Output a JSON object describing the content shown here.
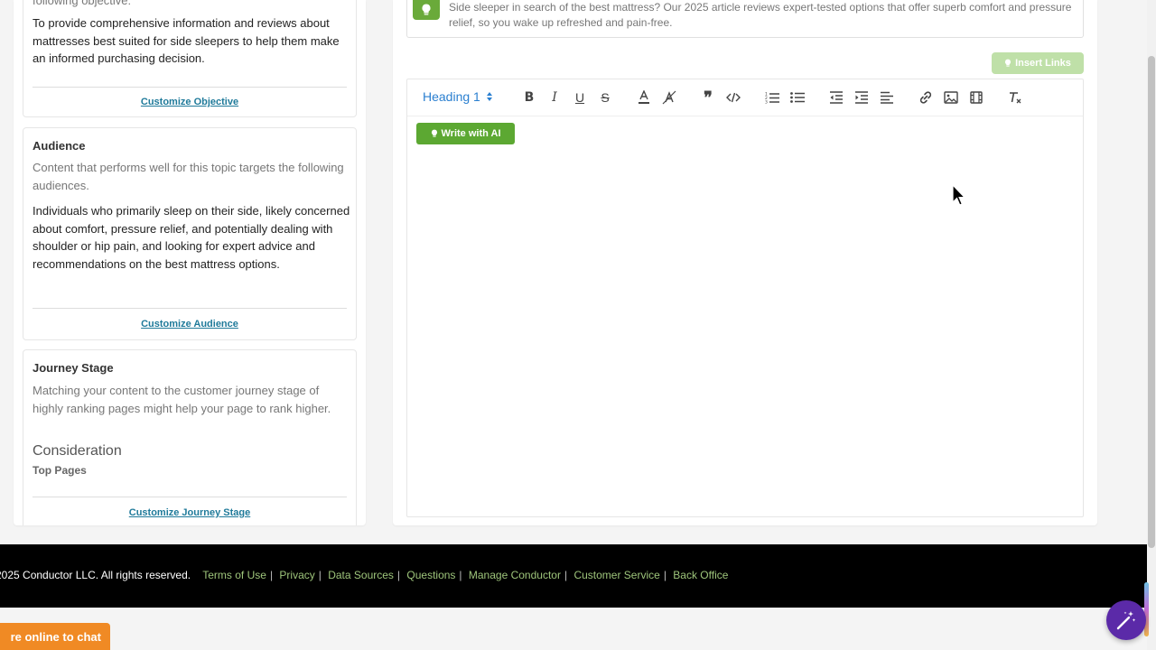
{
  "objective_card": {
    "partial_heading": "following objective:",
    "text": "To provide comprehensive information and reviews about mattresses best suited for side sleepers to help them make an informed purchasing decision.",
    "link": "Customize Objective"
  },
  "audience_card": {
    "title": "Audience",
    "description": "Content that performs well for this topic targets the following audiences.",
    "text": "Individuals who primarily sleep on their side, likely concerned about comfort, pressure relief, and potentially dealing with shoulder or hip pain, and looking for expert advice and recommendations on the best mattress options.",
    "link": "Customize Audience"
  },
  "journey_card": {
    "title": "Journey Stage",
    "description": "Matching your content to the customer journey stage of highly ranking pages might help your page to rank higher.",
    "stage": "Consideration",
    "top_pages": "Top Pages",
    "link": "Customize Journey Stage"
  },
  "meta_description": "Side sleeper in search of the best mattress? Our 2025 article reviews expert-tested options that offer superb comfort and pressure relief, so you wake up refreshed and pain-free.",
  "insert_links": "Insert Links",
  "toolbar": {
    "heading_select": "Heading 1",
    "buttons": [
      "bold-icon",
      "italic-icon",
      "underline-icon",
      "strikethrough-icon",
      "font-color-icon",
      "highlight-icon",
      "blockquote-icon",
      "code-icon",
      "ordered-list-icon",
      "bullet-list-icon",
      "outdent-icon",
      "indent-icon",
      "align-icon",
      "link-icon",
      "image-icon",
      "video-icon",
      "clear-format-icon"
    ]
  },
  "write_ai": "Write with AI",
  "footer": {
    "copyright": "2025 Conductor LLC. All rights reserved.",
    "links": [
      "Terms of Use",
      "Privacy",
      "Data Sources",
      "Questions",
      "Manage Conductor",
      "Customer Service",
      "Back Office"
    ]
  },
  "chat_tab": "re online to chat",
  "colors": {
    "accent_green": "#5ca832",
    "link_blue": "#1f7a9a",
    "footer_link": "#9ec57b",
    "chat_orange": "#f08a24",
    "magic_purple": "#5b2aa8"
  }
}
